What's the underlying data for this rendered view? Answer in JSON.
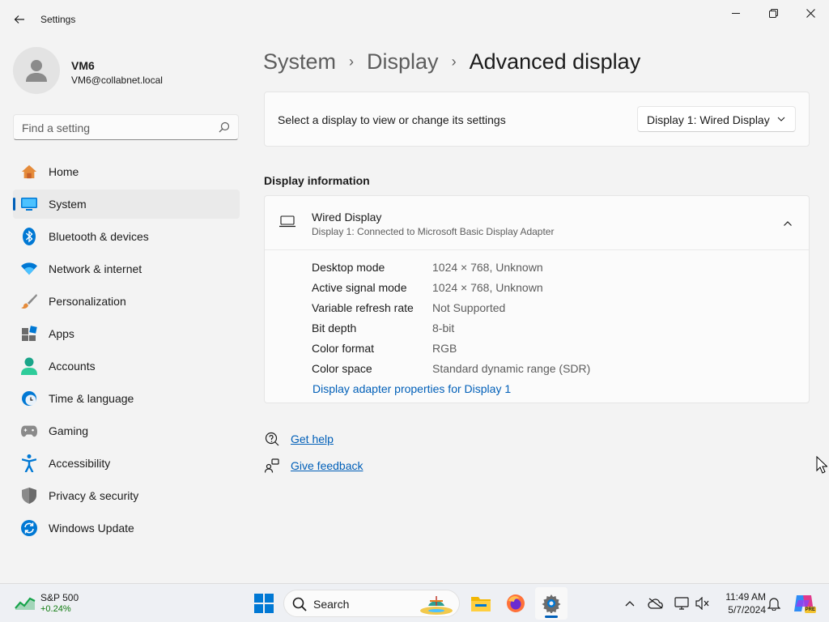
{
  "window": {
    "title": "Settings"
  },
  "profile": {
    "name": "VM6",
    "email": "VM6@collabnet.local"
  },
  "search": {
    "placeholder": "Find a setting"
  },
  "nav": {
    "items": [
      {
        "label": "Home",
        "icon": "home-icon"
      },
      {
        "label": "System",
        "icon": "system-icon",
        "active": true
      },
      {
        "label": "Bluetooth & devices",
        "icon": "bluetooth-icon"
      },
      {
        "label": "Network & internet",
        "icon": "wifi-icon"
      },
      {
        "label": "Personalization",
        "icon": "brush-icon"
      },
      {
        "label": "Apps",
        "icon": "apps-icon"
      },
      {
        "label": "Accounts",
        "icon": "accounts-icon"
      },
      {
        "label": "Time & language",
        "icon": "clock-globe-icon"
      },
      {
        "label": "Gaming",
        "icon": "gamepad-icon"
      },
      {
        "label": "Accessibility",
        "icon": "accessibility-icon"
      },
      {
        "label": "Privacy & security",
        "icon": "shield-icon"
      },
      {
        "label": "Windows Update",
        "icon": "update-icon"
      }
    ]
  },
  "breadcrumb": {
    "parts": [
      "System",
      "Display"
    ],
    "current": "Advanced display",
    "separator": "›"
  },
  "select_display": {
    "label": "Select a display to view or change its settings",
    "selected": "Display 1: Wired Display"
  },
  "display_info": {
    "section_title": "Display information",
    "name": "Wired Display",
    "subtitle": "Display 1: Connected to Microsoft Basic Display Adapter",
    "properties": [
      {
        "key": "Desktop mode",
        "value": "1024 × 768, Unknown"
      },
      {
        "key": "Active signal mode",
        "value": "1024 × 768, Unknown"
      },
      {
        "key": "Variable refresh rate",
        "value": "Not Supported"
      },
      {
        "key": "Bit depth",
        "value": "8-bit"
      },
      {
        "key": "Color format",
        "value": "RGB"
      },
      {
        "key": "Color space",
        "value": "Standard dynamic range (SDR)"
      }
    ],
    "adapter_link": "Display adapter properties for Display 1"
  },
  "help": {
    "get_help": "Get help",
    "give_feedback": "Give feedback"
  },
  "taskbar": {
    "widget_name": "S&P 500",
    "widget_change": "+0.24%",
    "search_label": "Search",
    "time": "11:49 AM",
    "date": "5/7/2024",
    "copilot_badge": "PRE"
  },
  "colors": {
    "accent": "#005fb8",
    "background": "#f3f3f3",
    "card": "#fbfbfb",
    "positive": "#0f7b0f"
  }
}
